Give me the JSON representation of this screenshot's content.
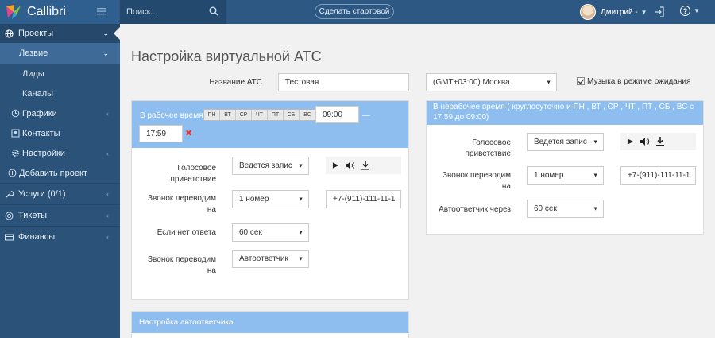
{
  "app": {
    "name": "Callibri"
  },
  "topbar": {
    "search_placeholder": "Поиск...",
    "start_button": "Сделать стартовой",
    "user_name": "Дмитрий -",
    "help_label": "?"
  },
  "sidebar": {
    "items": [
      {
        "label": "Проекты"
      },
      {
        "label": "Лезвие"
      },
      {
        "label": "Лиды"
      },
      {
        "label": "Каналы"
      },
      {
        "label": "Графики"
      },
      {
        "label": "Контакты"
      },
      {
        "label": "Настройки"
      },
      {
        "label": "Добавить проект"
      },
      {
        "label": "Услуги (0/1)"
      },
      {
        "label": "Тикеты"
      },
      {
        "label": "Финансы"
      }
    ]
  },
  "page": {
    "title": "Настройка виртуальной АТС",
    "ats_name_label": "Название АТС",
    "ats_name_value": "Тестовая",
    "timezone": "(GMT+03:00) Москва",
    "music_label": "Музыка в режиме ожидания"
  },
  "work_panel": {
    "title": "В рабочее время",
    "days": [
      "ПН",
      "ВТ",
      "СР",
      "ЧТ",
      "ПТ",
      "СБ",
      "ВС"
    ],
    "time_from": "09:00",
    "dash": "—",
    "time_to": "17:59",
    "greeting_label_1": "Голосовое",
    "greeting_label_2": "приветствие",
    "greeting_value": "Ведется запис",
    "transfer_label_1": "Звонок переводим",
    "transfer_label_2": "на",
    "transfer_value": "1 номер",
    "phone_value": "+7-(911)-111-11-1",
    "no_answer_label": "Если нет ответа",
    "no_answer_value": "60 сек",
    "transfer2_label_1": "Звонок переводим",
    "transfer2_label_2": "на",
    "transfer2_value": "Автоответчик"
  },
  "off_panel": {
    "title_1": "В нерабочее время ( круглосуточно и ПН , ВТ , СР , ЧТ , ПТ , СБ , ВС с",
    "title_2": "17:59 до 09:00)",
    "greeting_label_1": "Голосовое",
    "greeting_label_2": "приветствие",
    "greeting_value": "Ведется запис",
    "transfer_label_1": "Звонок переводим",
    "transfer_label_2": "на",
    "transfer_value": "1 номер",
    "phone_value": "+7-(911)-111-11-1",
    "autoanswer_label": "Автоответчик через",
    "autoanswer_value": "60 сек"
  },
  "auto_panel": {
    "title": "Настройка автоответчика"
  },
  "colors": {
    "topbar": "#2d5883",
    "sidebar": "#2b5278",
    "panel_head": "#8ebef0"
  }
}
